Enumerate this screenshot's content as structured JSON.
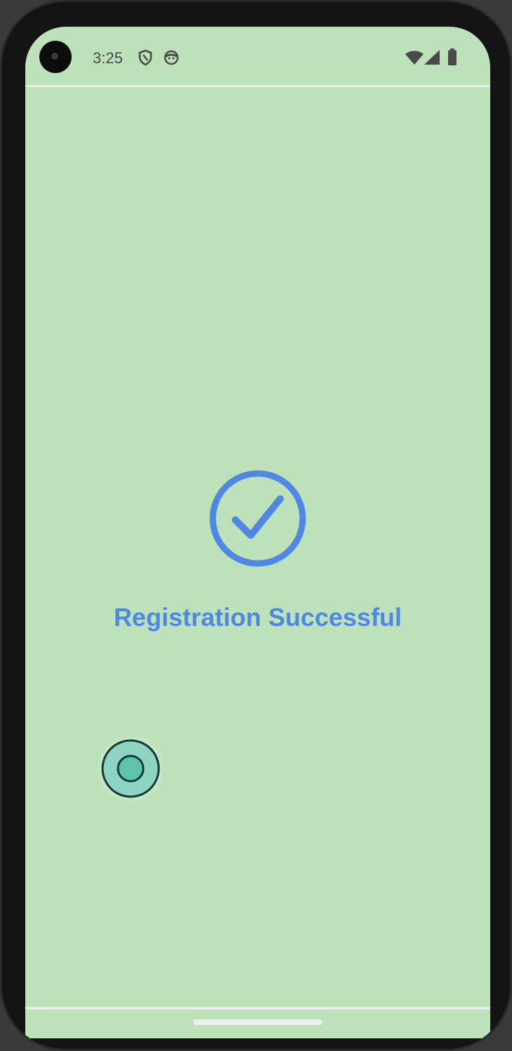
{
  "status_bar": {
    "time": "3:25",
    "icons": [
      "shield-icon",
      "android-face-icon",
      "wifi-icon",
      "cell-signal-icon",
      "battery-icon"
    ]
  },
  "main": {
    "success_icon": "check-circle-icon",
    "message": "Registration Successful"
  },
  "colors": {
    "background": "#bde1b9",
    "accent": "#4f88e4",
    "touch_indicator": "#5ec4ae"
  }
}
